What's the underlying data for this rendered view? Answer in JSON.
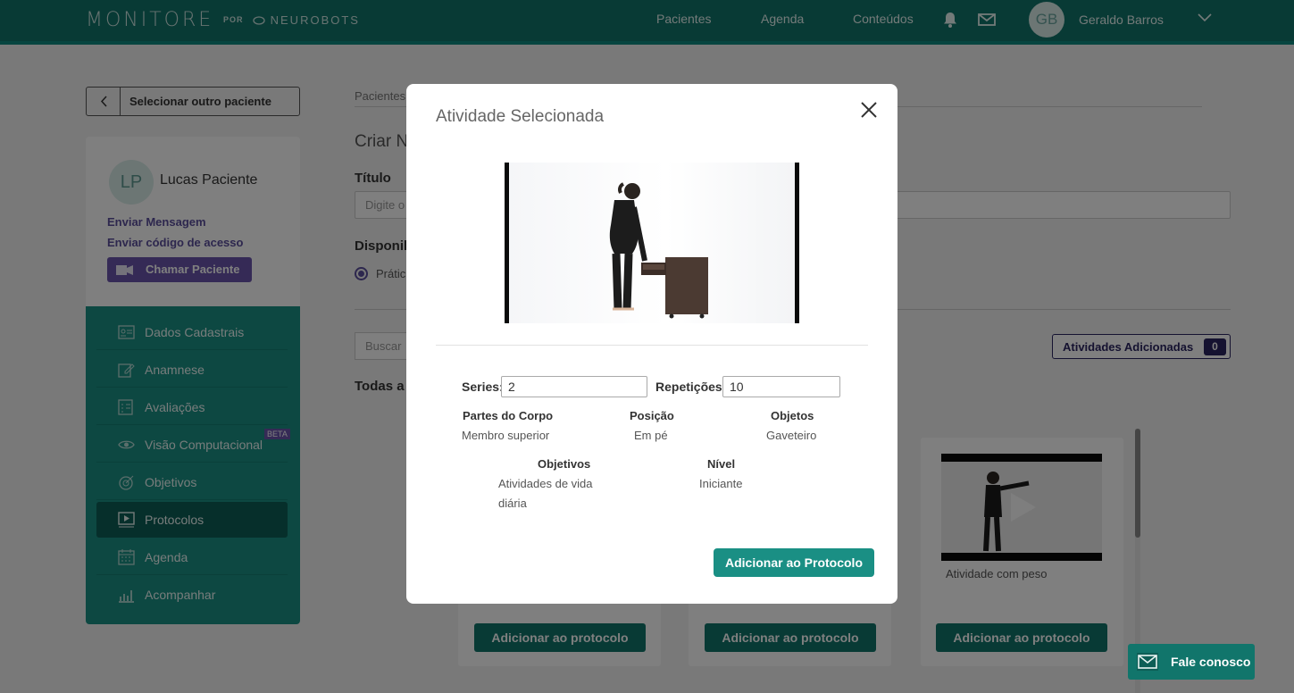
{
  "header": {
    "logo": "MONITORE",
    "logo_por": "POR",
    "logo_brand": "NEUROBOTS",
    "nav": [
      "Pacientes",
      "Agenda",
      "Conteúdos"
    ],
    "avatar_initials": "GB",
    "user_name": "Geraldo Barros"
  },
  "sidebar": {
    "back_label": "Selecionar outro paciente",
    "patient_initials": "LP",
    "patient_name": "Lucas Paciente",
    "send_message": "Enviar Mensagem",
    "send_code": "Enviar código de acesso",
    "call_button": "Chamar Paciente",
    "items": [
      {
        "label": "Dados Cadastrais",
        "icon": "id-card-icon"
      },
      {
        "label": "Anamnese",
        "icon": "edit-icon"
      },
      {
        "label": "Avaliações",
        "icon": "checklist-icon"
      },
      {
        "label": "Visão Computacional",
        "icon": "eye-icon",
        "badge": "BETA"
      },
      {
        "label": "Objetivos",
        "icon": "target-icon"
      },
      {
        "label": "Protocolos",
        "icon": "video-icon",
        "active": true
      },
      {
        "label": "Agenda",
        "icon": "calendar-icon"
      },
      {
        "label": "Acompanhar",
        "icon": "chart-icon"
      }
    ]
  },
  "main": {
    "breadcrumb": "Pacientes",
    "page_title": "Criar N",
    "title_label": "Título",
    "title_placeholder": "Digite o",
    "available_label": "Disponil",
    "radio_label": "Prátic",
    "search_placeholder": "Buscar",
    "added_label": "Atividades Adicionadas",
    "added_count": "0",
    "all_label": "Todas a",
    "card_title": "Atividade com peso",
    "add_buttons": [
      "Adicionar ao protocolo",
      "Adicionar ao protocolo",
      "Adicionar ao protocolo"
    ]
  },
  "modal": {
    "title": "Atividade Selecionada",
    "series_label": "Series:",
    "series_value": "2",
    "reps_label": "Repetições:",
    "reps_value": "10",
    "body_parts_label": "Partes do Corpo",
    "body_parts_value": "Membro superior",
    "position_label": "Posição",
    "position_value": "Em pé",
    "objects_label": "Objetos",
    "objects_value": "Gaveteiro",
    "goals_label": "Objetivos",
    "goals_value_1": "Atividades de vida",
    "goals_value_2": "diária",
    "level_label": "Nível",
    "level_value": "Iniciante",
    "add_button": "Adicionar ao Protocolo"
  },
  "fale_conosco": "Fale conosco",
  "colors": {
    "primary": "#11756b",
    "menu": "#1a9085",
    "accent_purple": "#6b55ad",
    "navy": "#2a2560"
  }
}
